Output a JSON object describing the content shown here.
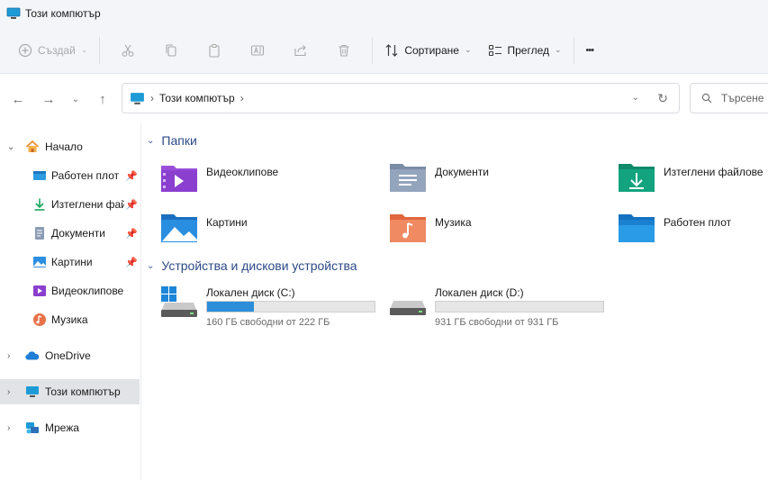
{
  "window": {
    "title": "Този компютър"
  },
  "toolbar": {
    "new_label": "Създай",
    "sort_label": "Сортиране",
    "view_label": "Преглед",
    "more_label": "•••",
    "icons": [
      "cut-icon",
      "copy-icon",
      "paste-icon",
      "rename-icon",
      "share-icon",
      "delete-icon"
    ]
  },
  "address": {
    "crumb_sep": "›",
    "location": "Този компютър",
    "search_placeholder": "Търсене"
  },
  "sidebar": {
    "items": [
      {
        "label": "Начало",
        "icon": "home-icon",
        "pinned": false
      },
      {
        "label": "Работен плот",
        "icon": "desktop-icon",
        "pinned": true
      },
      {
        "label": "Изтеглени фай",
        "icon": "downloads-icon",
        "pinned": true
      },
      {
        "label": "Документи",
        "icon": "documents-icon",
        "pinned": true
      },
      {
        "label": "Картини",
        "icon": "pictures-icon",
        "pinned": true
      },
      {
        "label": "Видеоклипове",
        "icon": "videos-icon",
        "pinned": false
      },
      {
        "label": "Музика",
        "icon": "music-icon",
        "pinned": false
      },
      {
        "label": "OneDrive",
        "icon": "onedrive-icon",
        "pinned": false
      },
      {
        "label": "Този компютър",
        "icon": "this-pc-icon",
        "pinned": false,
        "selected": true
      },
      {
        "label": "Мрежа",
        "icon": "network-icon",
        "pinned": false
      }
    ]
  },
  "folders_section": {
    "title": "Папки",
    "items": [
      {
        "label": "Видеоклипове",
        "icon": "videos-folder-icon"
      },
      {
        "label": "Документи",
        "icon": "documents-folder-icon"
      },
      {
        "label": "Изтеглени файлове",
        "icon": "downloads-folder-icon"
      },
      {
        "label": "Картини",
        "icon": "pictures-folder-icon"
      },
      {
        "label": "Музика",
        "icon": "music-folder-icon"
      },
      {
        "label": "Работен плот",
        "icon": "desktop-folder-icon"
      }
    ]
  },
  "drives_section": {
    "title": "Устройства и дискови устройства",
    "items": [
      {
        "name": "Локален диск (C:)",
        "free_text": "160 ГБ свободни от 222 ГБ",
        "used_fraction": 0.28
      },
      {
        "name": "Локален диск (D:)",
        "free_text": "931 ГБ свободни от 931 ГБ",
        "used_fraction": 0.0
      }
    ]
  },
  "colors": {
    "accent": "#2c8ed8",
    "section_header": "#2d4a87",
    "chrome_bg": "#f3f5f9"
  }
}
